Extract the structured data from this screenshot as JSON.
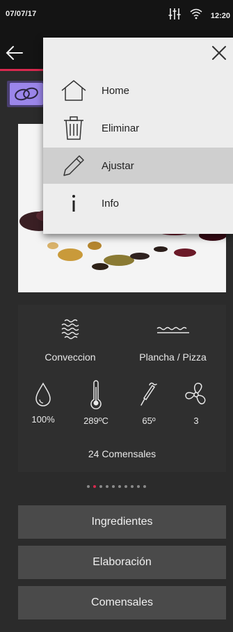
{
  "status_bar": {
    "date": "07/07/17",
    "time": "12:20",
    "icons": [
      "equalizer-icon",
      "wifi-icon"
    ]
  },
  "app_bar": {
    "back_icon": "back-arrow-icon"
  },
  "menu": {
    "close_icon": "close-icon",
    "items": [
      {
        "label": "Home",
        "icon": "home-icon",
        "selected": false
      },
      {
        "label": "Eliminar",
        "icon": "trash-icon",
        "selected": false
      },
      {
        "label": "Ajustar",
        "icon": "pencil-icon",
        "selected": true
      },
      {
        "label": "Info",
        "icon": "info-icon",
        "selected": false
      }
    ]
  },
  "panel": {
    "modes": [
      {
        "label": "Conveccion",
        "icon": "convection-icon"
      },
      {
        "label": "Plancha / Pizza",
        "icon": "griddle-icon"
      }
    ],
    "metrics": [
      {
        "value": "100%",
        "icon": "humidity-drop-icon"
      },
      {
        "value": "289ºC",
        "icon": "thermometer-icon"
      },
      {
        "value": "65º",
        "icon": "probe-icon"
      },
      {
        "value": "3",
        "icon": "fan-icon"
      }
    ],
    "comensales": "24 Comensales"
  },
  "pager": {
    "count": 10,
    "active": 1
  },
  "buttons": {
    "ingredientes": "Ingredientes",
    "elaboracion": "Elaboración",
    "comensales": "Comensales"
  },
  "colors": {
    "accent": "#d8294e",
    "strip": "#4a3f70",
    "strip_icon": "#9b86ea",
    "menu_bg": "#ededed",
    "menu_selected": "#cfcfcf"
  }
}
